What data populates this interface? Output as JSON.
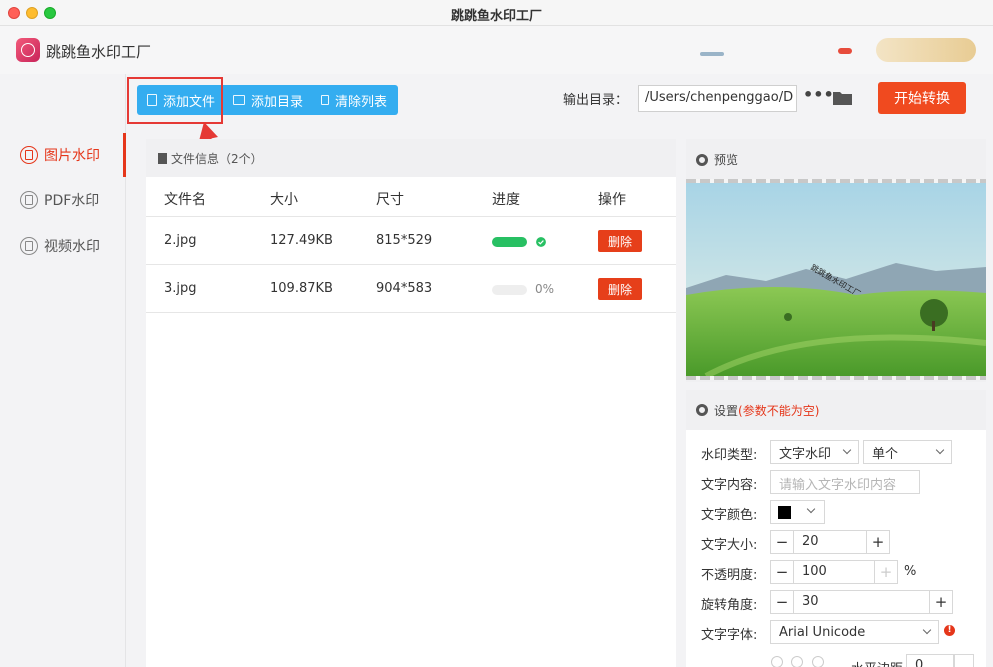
{
  "window": {
    "title": "跳跳鱼水印工厂"
  },
  "header": {
    "app_name": "跳跳鱼水印工厂"
  },
  "sidebar": {
    "items": [
      {
        "label": "图片水印",
        "active": true
      },
      {
        "label": "PDF水印",
        "active": false
      },
      {
        "label": "视频水印",
        "active": false
      }
    ]
  },
  "toolbar": {
    "add_file": "添加文件",
    "add_dir": "添加目录",
    "clear_list": "清除列表",
    "output_label": "输出目录：",
    "output_path": "/Users/chenpenggao/D",
    "more": "•••",
    "start": "开始转换"
  },
  "file_panel": {
    "title": "文件信息（2个）",
    "columns": [
      "文件名",
      "大小",
      "尺寸",
      "进度",
      "操作"
    ],
    "rows": [
      {
        "name": "2.jpg",
        "size": "127.49KB",
        "dims": "815*529",
        "progress": 1.0,
        "progress_text": "",
        "action": "删除"
      },
      {
        "name": "3.jpg",
        "size": "109.87KB",
        "dims": "904*583",
        "progress": 0.0,
        "progress_text": "0%",
        "action": "删除"
      }
    ]
  },
  "preview": {
    "title": "预览",
    "watermark_text": "跳跳鱼水印工厂"
  },
  "settings": {
    "title": "设置",
    "warning": "(参数不能为空)",
    "watermark_type_label": "水印类型:",
    "watermark_type": "文字水印",
    "watermark_mode": "单个",
    "text_content_label": "文字内容:",
    "text_content_placeholder": "请输入文字水印内容",
    "text_color_label": "文字颜色:",
    "text_color": "#000000",
    "text_size_label": "文字大小:",
    "text_size": "20",
    "opacity_label": "不透明度:",
    "opacity": "100",
    "opacity_unit": "%",
    "rotation_label": "旋转角度:",
    "rotation": "30",
    "font_label": "文字字体:",
    "font": "Arial Unicode",
    "horizontal_margin_label": "水平边距",
    "horizontal_margin": "0",
    "minus": "−",
    "plus": "+",
    "error_mark": "!"
  },
  "colors": {
    "accent_blue": "#34adf0",
    "accent_red": "#f04a1f",
    "progress_green": "#28c063",
    "highlight_red": "#e53935"
  }
}
